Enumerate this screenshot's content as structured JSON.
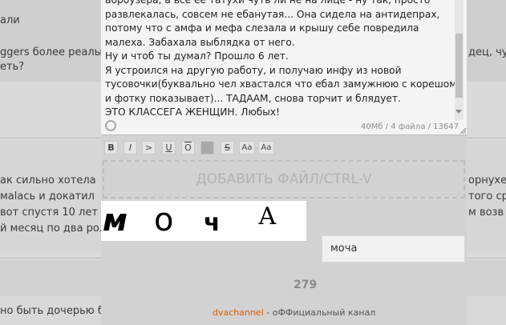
{
  "background_posts": {
    "line1": "али",
    "line2a": "ggers более реалы",
    "line2b": "дец, чу",
    "line3": "еть?",
    "line4a": "ак сильно хотела",
    "line4b": "орнуxе,",
    "line5a": "мalась и докатил",
    "line5b": "того ср",
    "line6a": "вот спустя 10 лет в",
    "line6b": "м возв",
    "line7": "й месяц по два рол",
    "line8": "но быть дочерью б"
  },
  "reply_form": {
    "message_lines": [
      "абрбузера, а все ее татухи чуть ли не на лице - ну так, просто",
      "развлекалась, совсем не ебанутая... Она сидела на антидепрах,",
      "потому что с амфа и мефа слезала и крышу себе повредила",
      "малеха. Забахала выблядка от него.",
      "Ну и чтоб ты думал? Прошло 6 лет.",
      "Я устроился на другую работу, и получаю инфу из новой",
      "тусовочки(буквально чел хвастался что ебал замужнюю с корешом",
      "и фотку показывает)... ТАДААМ, снова торчит и блядует.",
      "ЭТО КЛАССЕГА ЖЕНЩИН. Любых!"
    ],
    "counter": "40Мб / 4 файла / 13647",
    "toolbar": {
      "bold": "B",
      "italic": "I",
      "quote": ">",
      "underline": "U",
      "overline": "O",
      "spoiler": "",
      "strike": "S",
      "sup": "Aa",
      "sub": "Aa"
    },
    "dropzone_label": "ДОБАВИТЬ ФАЙЛ/CTRL-V",
    "captcha_glyphs": [
      "м",
      "о",
      "ч",
      "А"
    ],
    "captcha_value": "моча",
    "number": "279"
  },
  "footer": {
    "link": "dvachannel",
    "text": " - оФФициальный канал"
  }
}
